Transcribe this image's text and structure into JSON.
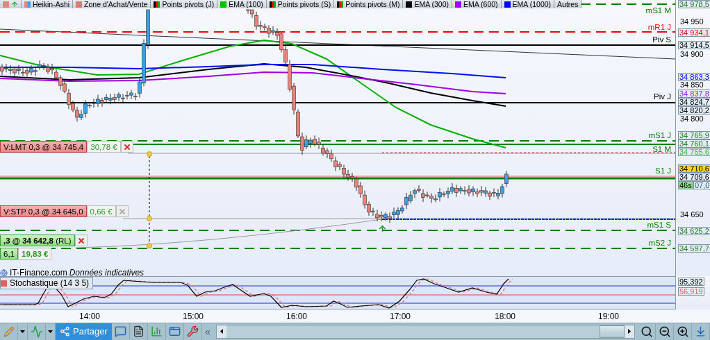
{
  "legend": [
    {
      "kind": "candles",
      "label": "Heikin-Ashi"
    },
    {
      "kind": "line",
      "label": "Zone d'Achat/Vente",
      "color": "#e07878"
    },
    {
      "kind": "pivot",
      "label": "Points pivots (J)"
    },
    {
      "kind": "line",
      "label": "EMA (100)",
      "color": "#00c000"
    },
    {
      "kind": "pivot",
      "label": "Points pivots (S)"
    },
    {
      "kind": "pivot",
      "label": "Points pivots (M)"
    },
    {
      "kind": "line",
      "label": "EMA (300)",
      "color": "#000000"
    },
    {
      "kind": "line",
      "label": "EMA (600)",
      "color": "#a000ff"
    },
    {
      "kind": "line",
      "label": "EMA (1000)",
      "color": "#0000ff"
    },
    {
      "kind": "text",
      "label": "Autres"
    }
  ],
  "level_lines": [
    {
      "kind": "dashed",
      "label": "mS1 M",
      "color": "#008000"
    },
    {
      "kind": "dashed",
      "label": "mR1 J",
      "color": "#ff0000"
    },
    {
      "kind": "solid",
      "label": "Piv S",
      "color": "#000000"
    },
    {
      "kind": "solid",
      "label": "Piv J",
      "color": "#000000"
    },
    {
      "kind": "dashed",
      "label": "mS1 J",
      "color": "#008000"
    },
    {
      "kind": "solid",
      "label": "S1 M",
      "color": "#008000"
    },
    {
      "kind": "solid",
      "label": "S1 J",
      "color": "#008000"
    },
    {
      "kind": "dashed",
      "label": "mS1 S",
      "color": "#008000"
    },
    {
      "kind": "dashed",
      "label": "mS2 J",
      "color": "#008000"
    }
  ],
  "orders": [
    {
      "kind": "sell",
      "label": "V:LMT  0,3 @ 34 745,4",
      "pnl": "30,78 €",
      "cancel": true,
      "disabled": false
    },
    {
      "kind": "sell",
      "label": "V:STP  0,3 @ 34 645,0",
      "pnl": "0,66 €",
      "cancel": true,
      "disabled": true
    },
    {
      "kind": "buy",
      "label": "**,3 @ 34 642,8** (RL)",
      "cancel": true,
      "disabled": false
    },
    {
      "kind": "buy",
      "label": "6,1",
      "pnl": "19,83 €",
      "cancel": false
    }
  ],
  "price_axis": {
    "ticks": [
      "34 950",
      "34 900",
      "34 850",
      "34 800",
      "34 650"
    ],
    "tags": [
      {
        "kind": "tag",
        "label": "34 978,5",
        "color": "#208020"
      },
      {
        "kind": "tag",
        "label": "34 934,1",
        "color": "#ff0000"
      },
      {
        "kind": "tag",
        "label": "34 914,5",
        "color": "#000000"
      },
      {
        "kind": "tag",
        "label": "34 863,3",
        "color": "#0000ff"
      },
      {
        "kind": "tag",
        "label": "34 837,8",
        "color": "#a020f0"
      },
      {
        "kind": "tag",
        "label": "34 824,7",
        "color": "#000000"
      },
      {
        "kind": "tag",
        "label": "34 820,2",
        "color": "#000000"
      },
      {
        "kind": "tag",
        "label": "34 765,9",
        "color": "#208020"
      },
      {
        "kind": "tag",
        "label": "34 760,1",
        "color": "#208020"
      },
      {
        "kind": "tag",
        "label": "34 755,6",
        "color": "#30c030"
      },
      {
        "kind": "highlight",
        "label": "34 710,6"
      },
      {
        "kind": "tag",
        "label": "34 709,6",
        "color": "#000000"
      },
      {
        "kind": "timer",
        "label": "46s"
      },
      {
        "kind": "tag",
        "label": "07,0"
      },
      {
        "kind": "tag",
        "label": "34 625,2",
        "color": "#208020"
      },
      {
        "kind": "tag",
        "label": "34 597,7",
        "color": "#208020"
      }
    ]
  },
  "footer": {
    "source": "IT-Finance.com",
    "note": "Données indicatives"
  },
  "indicator": {
    "label": "Stochastique (14 3 5)",
    "color": "#e06060",
    "tags": [
      {
        "label": "95,392",
        "color": "#000000"
      },
      {
        "label": "56,919",
        "color": "#e06060"
      }
    ]
  },
  "time_axis": [
    "14:00",
    "15:00",
    "16:00",
    "17:00",
    "18:00",
    "19:00"
  ],
  "toolbar": {
    "share": "Partager",
    "collapse": "«"
  }
}
